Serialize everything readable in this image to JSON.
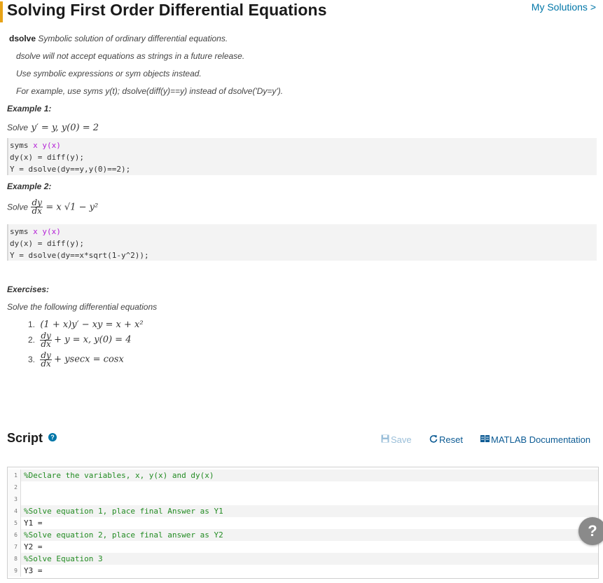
{
  "header": {
    "title": "Solving First Order Differential Equations",
    "my_solutions": "My Solutions >"
  },
  "description": {
    "keyword": "dsolve",
    "summary": " Symbolic solution of ordinary differential equations.",
    "note1": "dsolve will not accept equations as strings in a future release.",
    "note2": "Use symbolic expressions or sym objects instead.",
    "note3": "For example, use syms y(t); dsolve(diff(y)==y) instead of  dsolve('Dy=y')."
  },
  "example1": {
    "heading": "Example 1:",
    "prompt": "Solve",
    "equation": "y′ = y, y(0) = 2",
    "code": {
      "line1_kw": "syms",
      "line1_args": " x y(x)",
      "line2": "dy(x) = diff(y);",
      "line3": "Y = dsolve(dy==y,y(0)==2);"
    }
  },
  "example2": {
    "heading": "Example 2:",
    "prompt": "Solve",
    "frac_num": "dy",
    "frac_den": "dx",
    "rhs": "= x √1 − y²",
    "code": {
      "line1_kw": "syms",
      "line1_args": " x y(x)",
      "line2": "dy(x) = diff(y);",
      "line3": "Y = dsolve(dy==x*sqrt(1-y^2));"
    }
  },
  "exercises": {
    "heading": "Exercises:",
    "intro": "Solve the following differential equations",
    "items": [
      {
        "label": "1.",
        "equation": "(1 + x)y′ − xy = x + x²"
      },
      {
        "label": "2.",
        "frac_num": "dy",
        "frac_den": "dx",
        "rest": "+ y = x, y(0) = 4"
      },
      {
        "label": "3.",
        "frac_num": "dy",
        "frac_den": "dx",
        "rest": "+ ysecx = cosx"
      }
    ]
  },
  "script": {
    "title": "Script",
    "help_glyph": "?",
    "save_label": "Save",
    "reset_label": "Reset",
    "doc_label": "MATLAB Documentation"
  },
  "editor": {
    "lines": [
      {
        "n": "1",
        "text": "%Declare the variables, x, y(x) and dy(x)",
        "kind": "comment"
      },
      {
        "n": "2",
        "text": "",
        "kind": "plain"
      },
      {
        "n": "3",
        "text": "",
        "kind": "plain"
      },
      {
        "n": "4",
        "text": "%Solve equation 1, place final Answer as Y1",
        "kind": "comment"
      },
      {
        "n": "5",
        "text": "Y1 =",
        "kind": "plain"
      },
      {
        "n": "6",
        "text": "%Solve equation 2, place final answer as Y2",
        "kind": "comment"
      },
      {
        "n": "7",
        "text": "Y2 =",
        "kind": "plain"
      },
      {
        "n": "8",
        "text": "%Solve Equation 3",
        "kind": "comment"
      },
      {
        "n": "9",
        "text": "Y3 =",
        "kind": "plain"
      }
    ]
  },
  "floating_help": {
    "glyph": "?"
  },
  "colors": {
    "accent": "#e8a317",
    "link": "#0076a8",
    "comment": "#228b22",
    "keyword": "#b41fd6"
  }
}
